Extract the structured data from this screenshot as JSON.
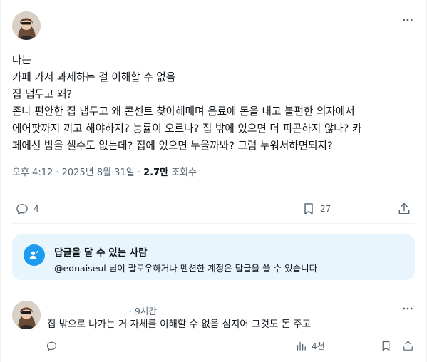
{
  "post": {
    "body_lines": [
      "나는",
      "카페 가서 과제하는 걸 이해할 수 없음",
      "집 냅두고 왜?",
      "존나 편안한 집 냅두고 왜 콘센트 찾아헤매며 음료에 돈을 내고 불편한 의자에서",
      "에어팟까지 끼고 해야하지? 능률이 오르나? 집 밖에 있으면 더 피곤하지 않나? 카",
      "페에선 밤을 샐수도 없는데? 집에 있으면 누울까봐? 그럼 누워서하면되지?"
    ],
    "timestamp": "오후 4:12 · 2025년 8월 31일 · ",
    "views_count": "2.7만",
    "views_label": " 조회수",
    "reply_count": "4",
    "bookmark_count": "27"
  },
  "reply_notice": {
    "title": "답글을 달 수 있는 사람",
    "handle": "@ednaiseul",
    "text": " 님이 팔로우하거나 멘션한 계정은 답글을 쓸 수 있습니다"
  },
  "reply": {
    "time": "· 9시간",
    "text": "집 밖으로 나가는 거 자체를 이해할 수 없음 심지어 그것도 돈 주고",
    "views": "4천"
  },
  "colors": {
    "accent": "#1d9bf0",
    "notice_bg": "#e8f5fd",
    "muted": "#536471",
    "text": "#0f1419",
    "divider": "#eff3f4"
  },
  "icons": [
    "more-icon",
    "reply-icon",
    "bookmark-icon",
    "share-icon",
    "mention-icon",
    "views-icon"
  ]
}
